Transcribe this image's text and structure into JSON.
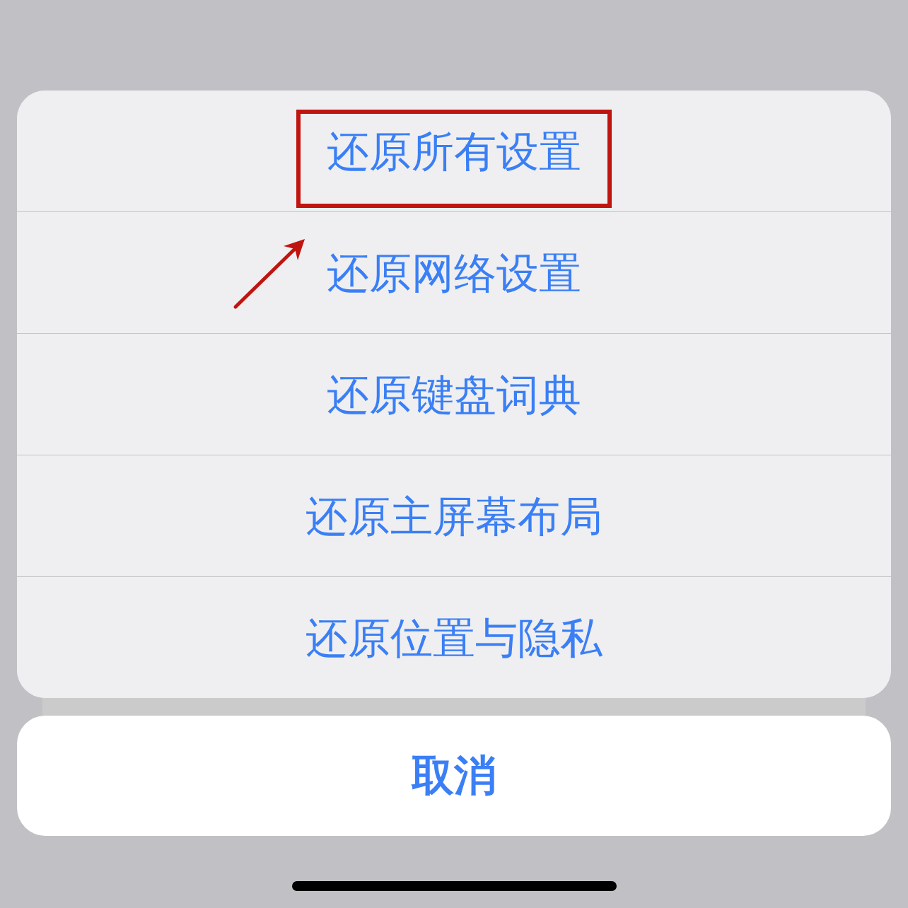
{
  "action_sheet": {
    "options": [
      {
        "label": "还原所有设置",
        "highlighted": true,
        "pointer_arrow": false
      },
      {
        "label": "还原网络设置",
        "highlighted": false,
        "pointer_arrow": true
      },
      {
        "label": "还原键盘词典",
        "highlighted": false,
        "pointer_arrow": false
      },
      {
        "label": "还原主屏幕布局",
        "highlighted": false,
        "pointer_arrow": false
      },
      {
        "label": "还原位置与隐私",
        "highlighted": false,
        "pointer_arrow": false
      }
    ]
  },
  "cancel_button": {
    "label": "取消"
  }
}
